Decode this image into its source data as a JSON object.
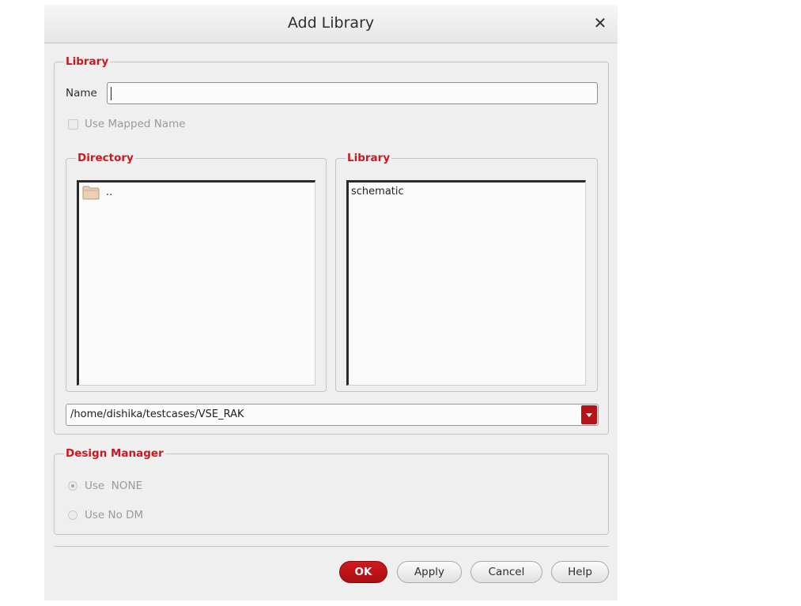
{
  "dialog": {
    "title": "Add Library",
    "close_glyph": "✕"
  },
  "library_group": {
    "legend": "Library",
    "name_label": "Name",
    "name_value": "",
    "use_mapped_name_label": "Use Mapped Name",
    "use_mapped_name_checked": false
  },
  "directory_panel": {
    "legend": "Directory",
    "items": [
      {
        "icon": "folder-icon",
        "label": ".."
      }
    ]
  },
  "library_panel": {
    "legend": "Library",
    "items": [
      {
        "label": "schematic"
      }
    ]
  },
  "path_combo": {
    "value": "/home/dishika/testcases/VSE_RAK"
  },
  "design_manager": {
    "legend": "Design Manager",
    "options": [
      {
        "label": "Use  NONE",
        "selected": true
      },
      {
        "label": "Use No DM",
        "selected": false
      }
    ]
  },
  "buttons": {
    "ok": "OK",
    "apply": "Apply",
    "cancel": "Cancel",
    "help": "Help"
  },
  "colors": {
    "accent": "#d0161c",
    "primary_button": "#b51317"
  }
}
